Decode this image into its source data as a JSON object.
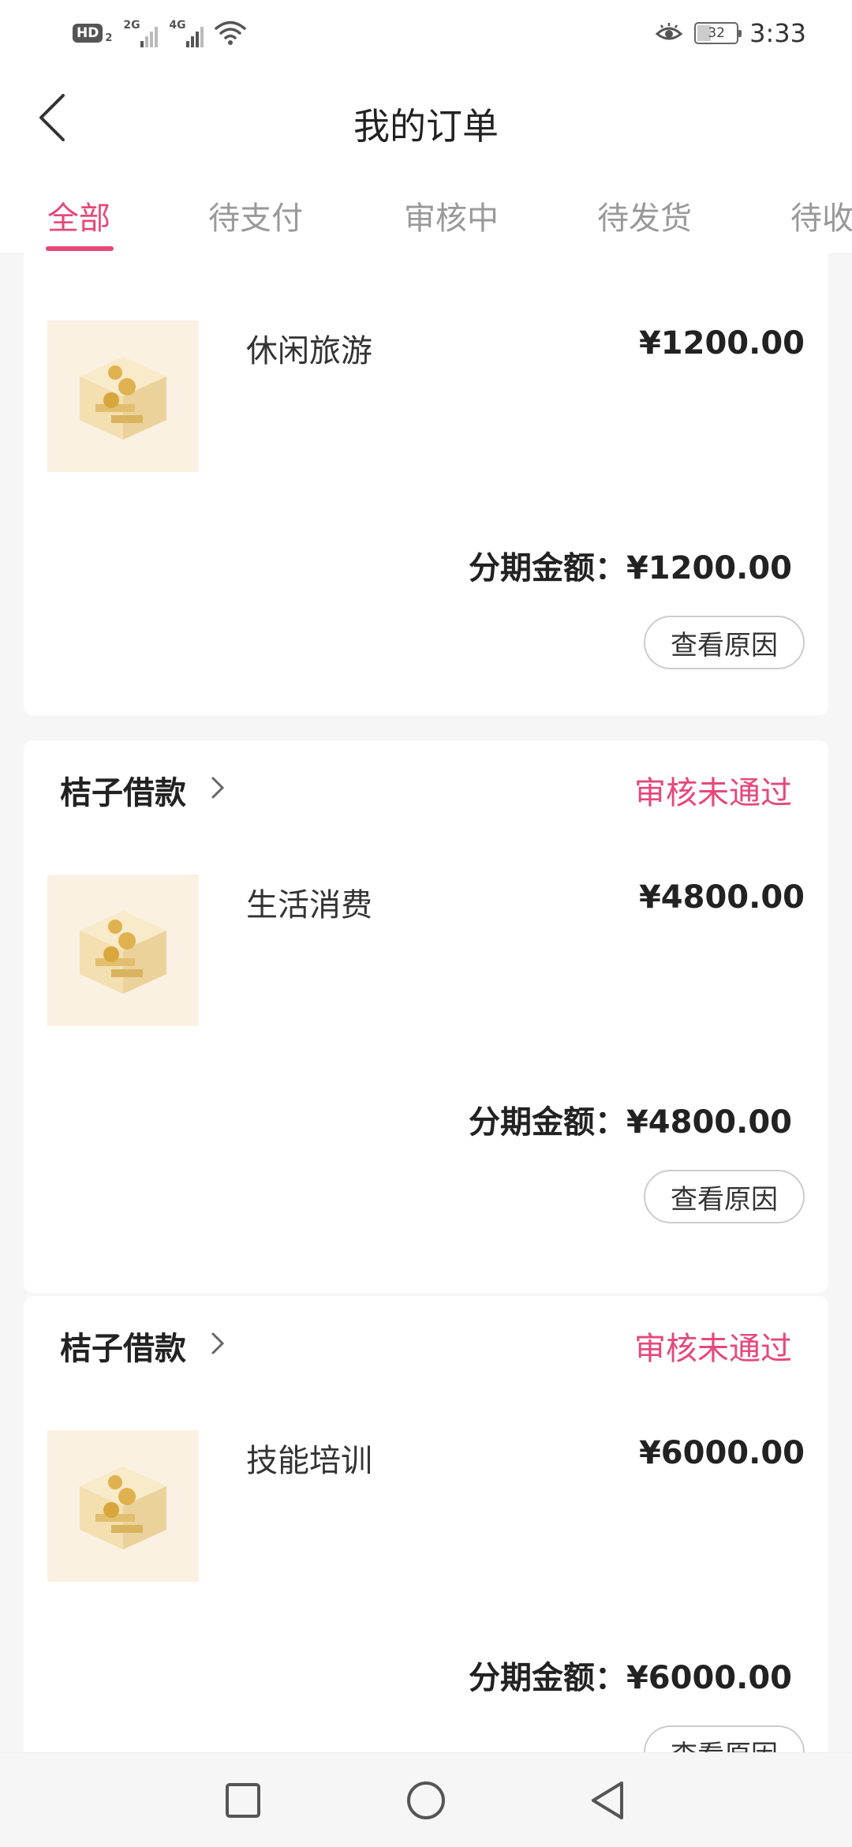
{
  "status_bar": {
    "hd_label": "HD",
    "hd_sub": "2",
    "sim1_network": "2G",
    "sim2_network": "4G",
    "battery_level": "32",
    "time": "3:33"
  },
  "header": {
    "title": "我的订单"
  },
  "tabs": [
    {
      "label": "全部",
      "active": true
    },
    {
      "label": "待支付",
      "active": false
    },
    {
      "label": "审核中",
      "active": false
    },
    {
      "label": "待发货",
      "active": false
    },
    {
      "label": "待收",
      "active": false
    }
  ],
  "orders": [
    {
      "shop_name": "",
      "status": "",
      "product_name": "休闲旅游",
      "price": "¥1200.00",
      "installment_label": "分期金额：",
      "installment_amount": "¥1200.00",
      "action_label": "查看原因"
    },
    {
      "shop_name": "桔子借款",
      "status": "审核未通过",
      "product_name": "生活消费",
      "price": "¥4800.00",
      "installment_label": "分期金额：",
      "installment_amount": "¥4800.00",
      "action_label": "查看原因"
    },
    {
      "shop_name": "桔子借款",
      "status": "审核未通过",
      "product_name": "技能培训",
      "price": "¥6000.00",
      "installment_label": "分期金额：",
      "installment_amount": "¥6000.00",
      "action_label": "查看原因"
    }
  ],
  "colors": {
    "accent": "#e6487a",
    "background": "#f6f6f6",
    "thumb_bg": "#fbf1e2"
  }
}
